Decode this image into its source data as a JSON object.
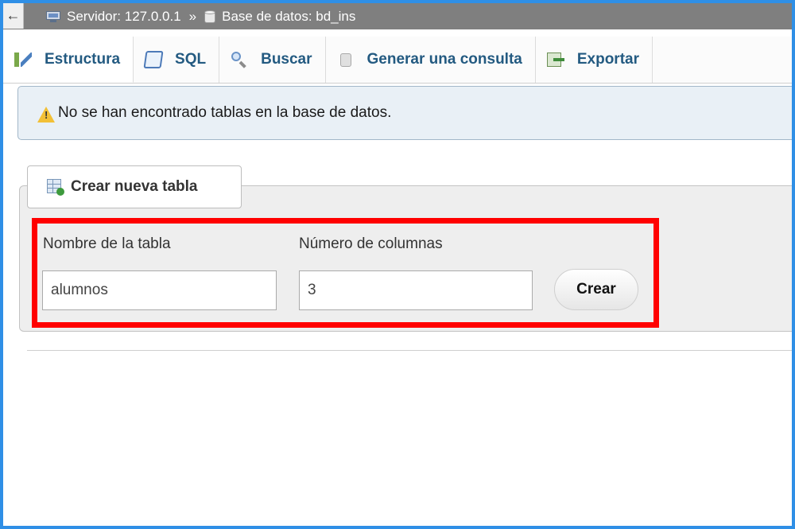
{
  "breadcrumb": {
    "back_symbol": "←",
    "server": "Servidor: 127.0.0.1",
    "separator": "»",
    "database": "Base de datos: bd_ins"
  },
  "tabs": [
    {
      "label": "Estructura",
      "icon": "structure-icon",
      "active": true
    },
    {
      "label": "SQL",
      "icon": "sql-icon",
      "active": false
    },
    {
      "label": "Buscar",
      "icon": "search-icon",
      "active": false
    },
    {
      "label": "Generar una consulta",
      "icon": "query-icon",
      "active": false
    },
    {
      "label": "Exportar",
      "icon": "export-icon",
      "active": false
    }
  ],
  "notice": {
    "message": "No se han encontrado tablas en la base de datos.",
    "icon": "warning-icon"
  },
  "create_table": {
    "legend": "Crear nueva tabla",
    "name_label": "Nombre de la tabla",
    "name_value": "alumnos",
    "columns_label": "Número de columnas",
    "columns_value": "3",
    "submit_label": "Crear"
  },
  "colors": {
    "frame_border": "#2f8fe6",
    "topbar_bg": "#7f7f7f",
    "tab_text": "#235a81",
    "highlight": "#ff0000"
  }
}
